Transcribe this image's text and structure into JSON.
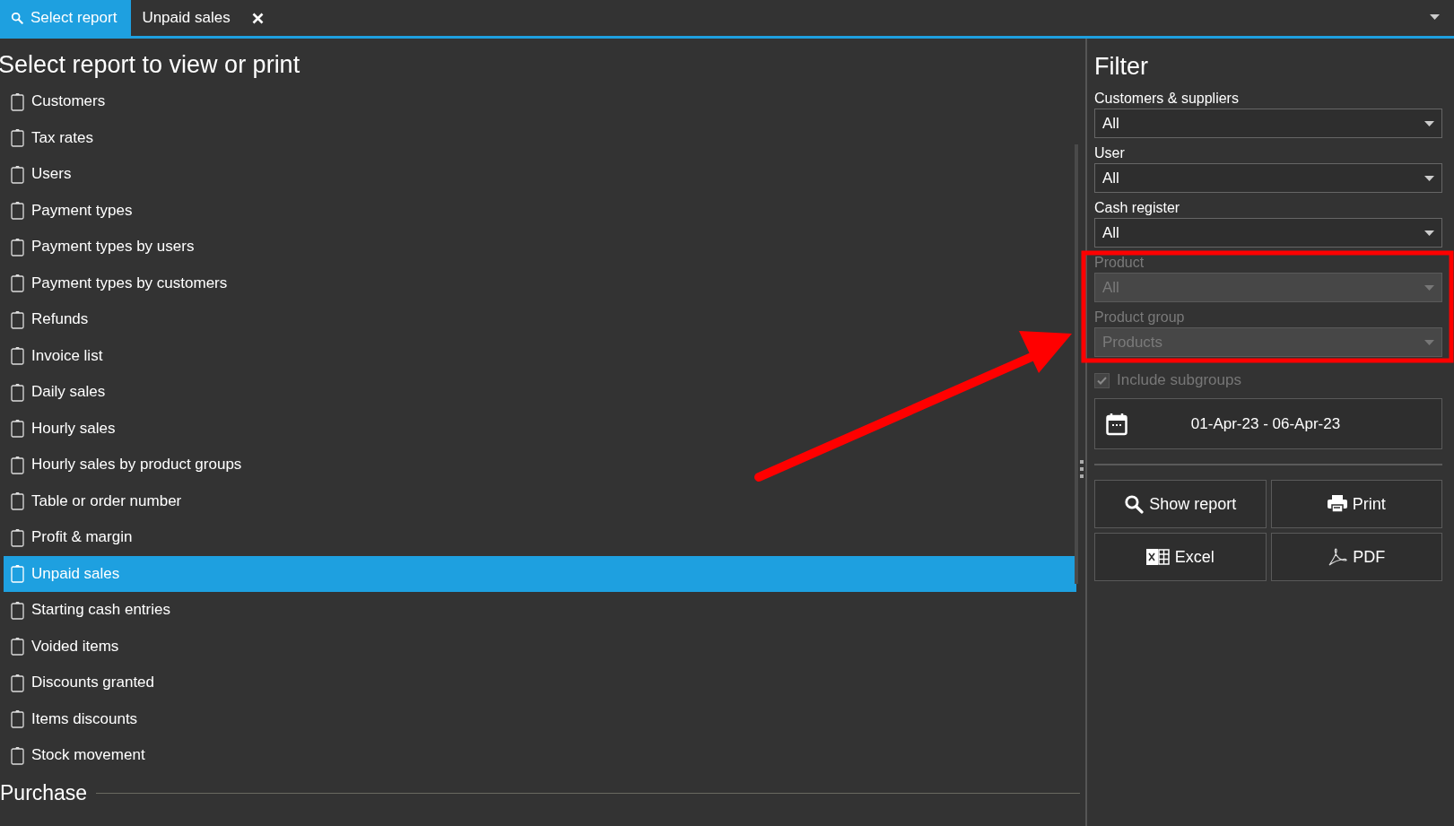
{
  "tabs": [
    {
      "label": "Select report",
      "selected": true,
      "kind": "search",
      "closable": false
    },
    {
      "label": "Unpaid sales",
      "selected": false,
      "closable": true
    }
  ],
  "reports": {
    "title": "Select report to view or print",
    "items": [
      {
        "label": "Customers",
        "selected": false
      },
      {
        "label": "Tax rates",
        "selected": false
      },
      {
        "label": "Users",
        "selected": false
      },
      {
        "label": "Payment types",
        "selected": false
      },
      {
        "label": "Payment types by users",
        "selected": false
      },
      {
        "label": "Payment types by customers",
        "selected": false
      },
      {
        "label": "Refunds",
        "selected": false
      },
      {
        "label": "Invoice list",
        "selected": false
      },
      {
        "label": "Daily sales",
        "selected": false
      },
      {
        "label": "Hourly sales",
        "selected": false
      },
      {
        "label": "Hourly sales by product groups",
        "selected": false
      },
      {
        "label": "Table or order number",
        "selected": false
      },
      {
        "label": "Profit & margin",
        "selected": false
      },
      {
        "label": "Unpaid sales",
        "selected": true
      },
      {
        "label": "Starting cash entries",
        "selected": false
      },
      {
        "label": "Voided items",
        "selected": false
      },
      {
        "label": "Discounts granted",
        "selected": false
      },
      {
        "label": "Items discounts",
        "selected": false
      },
      {
        "label": "Stock movement",
        "selected": false
      }
    ],
    "next_section": "Purchase"
  },
  "filter": {
    "title": "Filter",
    "fields": [
      {
        "label": "Customers & suppliers",
        "value": "All",
        "disabled": false
      },
      {
        "label": "User",
        "value": "All",
        "disabled": false
      },
      {
        "label": "Cash register",
        "value": "All",
        "disabled": false
      },
      {
        "label": "Product",
        "value": "All",
        "disabled": true
      },
      {
        "label": "Product group",
        "value": "Products",
        "disabled": true
      }
    ],
    "include_subgroups": {
      "label": "Include subgroups",
      "checked": true,
      "disabled": true
    },
    "date_range": "01-Apr-23 - 06-Apr-23",
    "actions": [
      {
        "label": "Show report",
        "kind": "search"
      },
      {
        "label": "Print",
        "kind": "print"
      },
      {
        "label": "Excel",
        "kind": "excel"
      },
      {
        "label": "PDF",
        "kind": "pdf"
      }
    ]
  }
}
